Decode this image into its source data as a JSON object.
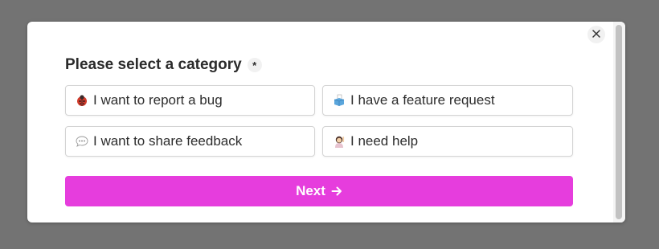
{
  "dialog": {
    "question": "Please select a category",
    "required_marker": "*",
    "options": [
      {
        "label": "I want to report a bug",
        "icon": "ladybug-icon"
      },
      {
        "label": "I have a feature request",
        "icon": "ballot-box-icon"
      },
      {
        "label": "I want to share feedback",
        "icon": "speech-bubble-icon"
      },
      {
        "label": "I need help",
        "icon": "person-raising-hand-icon"
      }
    ],
    "next_label": "Next",
    "accent_color": "#e63ddd"
  }
}
